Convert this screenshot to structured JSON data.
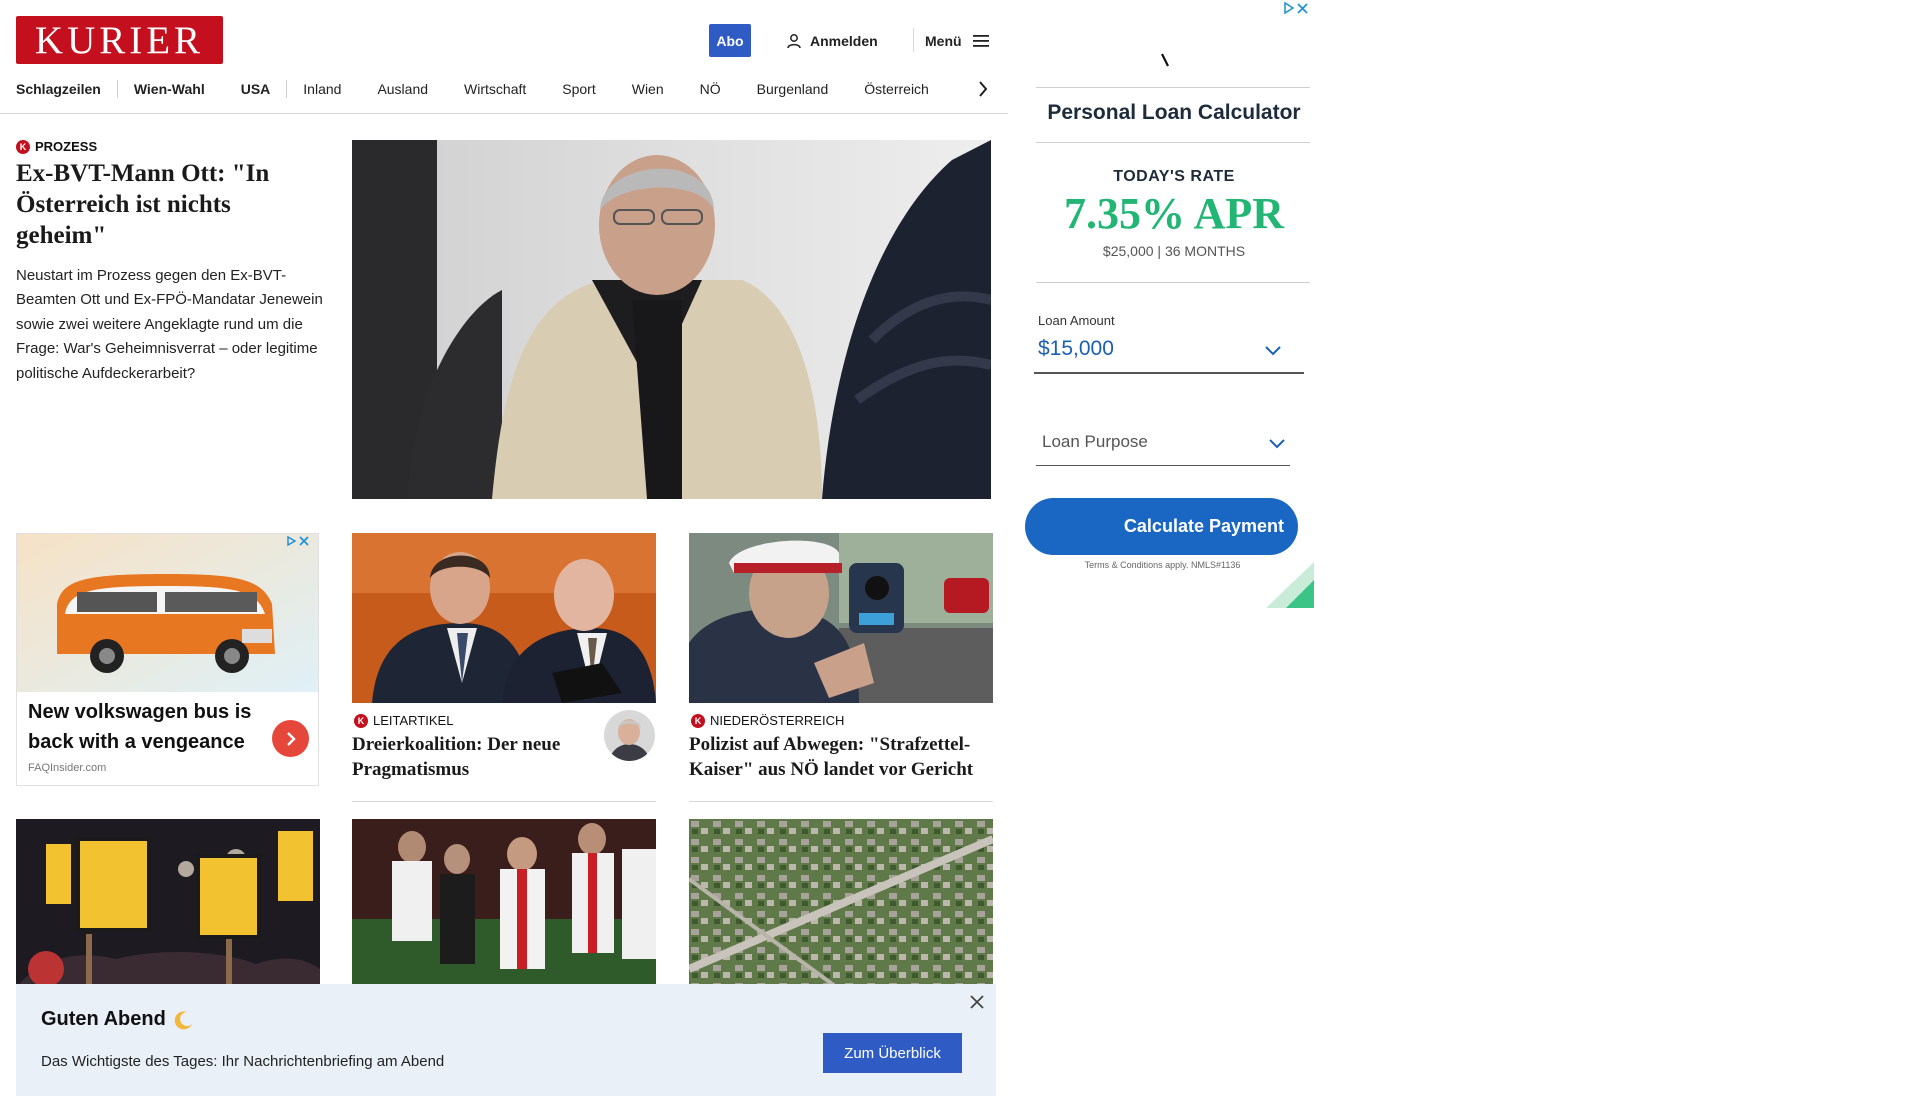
{
  "header": {
    "logo_text": "KURIER",
    "abo_label": "Abo",
    "login_label": "Anmelden",
    "menu_label": "Menü"
  },
  "nav": {
    "items": [
      "Schlagzeilen",
      "Wien-Wahl",
      "USA",
      "Inland",
      "Ausland",
      "Wirtschaft",
      "Sport",
      "Wien",
      "NÖ",
      "Burgenland",
      "Österreich"
    ]
  },
  "lead": {
    "kicker": "PROZESS",
    "title": "Ex-BVT-Mann Ott: \"In Österreich ist nichts geheim\"",
    "teaser": "Neustart im Prozess gegen den Ex-BVT-Beamten Ott und Ex-FPÖ-Mandatar Jenewein sowie zwei weitere Angeklagte rund um die Frage: War's Geheimnisverrat – oder legitime politische Aufdeckerarbeit?"
  },
  "ad_card": {
    "title": "New volkswagen bus is back with a vengeance",
    "source": "FAQInsider.com"
  },
  "cards": [
    {
      "kicker": "LEITARTIKEL",
      "title": "Dreierkoalition: Der neue Pragmatismus"
    },
    {
      "kicker": "NIEDERÖSTERREICH",
      "title": "Polizist auf Abwegen: \"Strafzettel-Kaiser\" aus NÖ landet vor Gericht"
    }
  ],
  "loan_ad": {
    "title": "Personal Loan Calculator",
    "rate_label": "TODAY'S RATE",
    "rate": "7.35% APR",
    "terms": "$25,000 | 36 MONTHS",
    "amount_label": "Loan Amount",
    "amount": "$15,000",
    "purpose_placeholder": "Loan Purpose",
    "button": "Calculate Payment",
    "fine_print": "Terms & Conditions apply. NMLS#1136"
  },
  "banner": {
    "title": "Guten Abend",
    "text": "Das Wichtigste des Tages: Ihr Nachrichtenbriefing am Abend",
    "button": "Zum Überblick"
  },
  "colors": {
    "brand_red": "#c4101e",
    "accent_blue": "#2f5cc4",
    "rate_green": "#22b573",
    "ad_button_blue": "#1967c2"
  }
}
